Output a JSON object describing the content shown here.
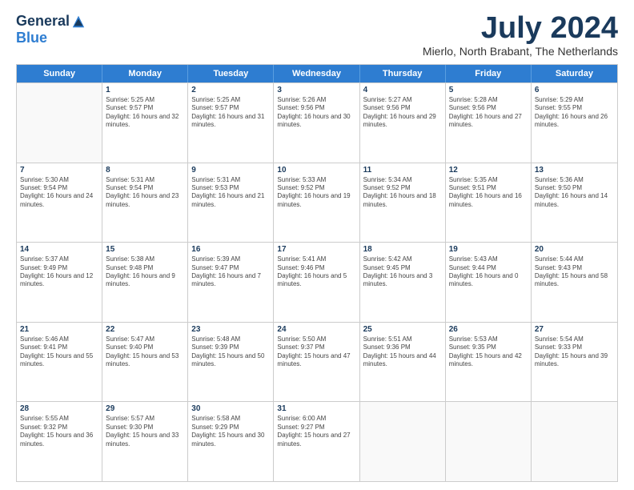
{
  "logo": {
    "general": "General",
    "blue": "Blue"
  },
  "header": {
    "month": "July 2024",
    "location": "Mierlo, North Brabant, The Netherlands"
  },
  "weekdays": [
    "Sunday",
    "Monday",
    "Tuesday",
    "Wednesday",
    "Thursday",
    "Friday",
    "Saturday"
  ],
  "rows": [
    [
      {
        "day": "",
        "empty": true
      },
      {
        "day": "1",
        "sunrise": "Sunrise: 5:25 AM",
        "sunset": "Sunset: 9:57 PM",
        "daylight": "Daylight: 16 hours and 32 minutes."
      },
      {
        "day": "2",
        "sunrise": "Sunrise: 5:25 AM",
        "sunset": "Sunset: 9:57 PM",
        "daylight": "Daylight: 16 hours and 31 minutes."
      },
      {
        "day": "3",
        "sunrise": "Sunrise: 5:26 AM",
        "sunset": "Sunset: 9:56 PM",
        "daylight": "Daylight: 16 hours and 30 minutes."
      },
      {
        "day": "4",
        "sunrise": "Sunrise: 5:27 AM",
        "sunset": "Sunset: 9:56 PM",
        "daylight": "Daylight: 16 hours and 29 minutes."
      },
      {
        "day": "5",
        "sunrise": "Sunrise: 5:28 AM",
        "sunset": "Sunset: 9:56 PM",
        "daylight": "Daylight: 16 hours and 27 minutes."
      },
      {
        "day": "6",
        "sunrise": "Sunrise: 5:29 AM",
        "sunset": "Sunset: 9:55 PM",
        "daylight": "Daylight: 16 hours and 26 minutes."
      }
    ],
    [
      {
        "day": "7",
        "sunrise": "Sunrise: 5:30 AM",
        "sunset": "Sunset: 9:54 PM",
        "daylight": "Daylight: 16 hours and 24 minutes."
      },
      {
        "day": "8",
        "sunrise": "Sunrise: 5:31 AM",
        "sunset": "Sunset: 9:54 PM",
        "daylight": "Daylight: 16 hours and 23 minutes."
      },
      {
        "day": "9",
        "sunrise": "Sunrise: 5:31 AM",
        "sunset": "Sunset: 9:53 PM",
        "daylight": "Daylight: 16 hours and 21 minutes."
      },
      {
        "day": "10",
        "sunrise": "Sunrise: 5:33 AM",
        "sunset": "Sunset: 9:52 PM",
        "daylight": "Daylight: 16 hours and 19 minutes."
      },
      {
        "day": "11",
        "sunrise": "Sunrise: 5:34 AM",
        "sunset": "Sunset: 9:52 PM",
        "daylight": "Daylight: 16 hours and 18 minutes."
      },
      {
        "day": "12",
        "sunrise": "Sunrise: 5:35 AM",
        "sunset": "Sunset: 9:51 PM",
        "daylight": "Daylight: 16 hours and 16 minutes."
      },
      {
        "day": "13",
        "sunrise": "Sunrise: 5:36 AM",
        "sunset": "Sunset: 9:50 PM",
        "daylight": "Daylight: 16 hours and 14 minutes."
      }
    ],
    [
      {
        "day": "14",
        "sunrise": "Sunrise: 5:37 AM",
        "sunset": "Sunset: 9:49 PM",
        "daylight": "Daylight: 16 hours and 12 minutes."
      },
      {
        "day": "15",
        "sunrise": "Sunrise: 5:38 AM",
        "sunset": "Sunset: 9:48 PM",
        "daylight": "Daylight: 16 hours and 9 minutes."
      },
      {
        "day": "16",
        "sunrise": "Sunrise: 5:39 AM",
        "sunset": "Sunset: 9:47 PM",
        "daylight": "Daylight: 16 hours and 7 minutes."
      },
      {
        "day": "17",
        "sunrise": "Sunrise: 5:41 AM",
        "sunset": "Sunset: 9:46 PM",
        "daylight": "Daylight: 16 hours and 5 minutes."
      },
      {
        "day": "18",
        "sunrise": "Sunrise: 5:42 AM",
        "sunset": "Sunset: 9:45 PM",
        "daylight": "Daylight: 16 hours and 3 minutes."
      },
      {
        "day": "19",
        "sunrise": "Sunrise: 5:43 AM",
        "sunset": "Sunset: 9:44 PM",
        "daylight": "Daylight: 16 hours and 0 minutes."
      },
      {
        "day": "20",
        "sunrise": "Sunrise: 5:44 AM",
        "sunset": "Sunset: 9:43 PM",
        "daylight": "Daylight: 15 hours and 58 minutes."
      }
    ],
    [
      {
        "day": "21",
        "sunrise": "Sunrise: 5:46 AM",
        "sunset": "Sunset: 9:41 PM",
        "daylight": "Daylight: 15 hours and 55 minutes."
      },
      {
        "day": "22",
        "sunrise": "Sunrise: 5:47 AM",
        "sunset": "Sunset: 9:40 PM",
        "daylight": "Daylight: 15 hours and 53 minutes."
      },
      {
        "day": "23",
        "sunrise": "Sunrise: 5:48 AM",
        "sunset": "Sunset: 9:39 PM",
        "daylight": "Daylight: 15 hours and 50 minutes."
      },
      {
        "day": "24",
        "sunrise": "Sunrise: 5:50 AM",
        "sunset": "Sunset: 9:37 PM",
        "daylight": "Daylight: 15 hours and 47 minutes."
      },
      {
        "day": "25",
        "sunrise": "Sunrise: 5:51 AM",
        "sunset": "Sunset: 9:36 PM",
        "daylight": "Daylight: 15 hours and 44 minutes."
      },
      {
        "day": "26",
        "sunrise": "Sunrise: 5:53 AM",
        "sunset": "Sunset: 9:35 PM",
        "daylight": "Daylight: 15 hours and 42 minutes."
      },
      {
        "day": "27",
        "sunrise": "Sunrise: 5:54 AM",
        "sunset": "Sunset: 9:33 PM",
        "daylight": "Daylight: 15 hours and 39 minutes."
      }
    ],
    [
      {
        "day": "28",
        "sunrise": "Sunrise: 5:55 AM",
        "sunset": "Sunset: 9:32 PM",
        "daylight": "Daylight: 15 hours and 36 minutes."
      },
      {
        "day": "29",
        "sunrise": "Sunrise: 5:57 AM",
        "sunset": "Sunset: 9:30 PM",
        "daylight": "Daylight: 15 hours and 33 minutes."
      },
      {
        "day": "30",
        "sunrise": "Sunrise: 5:58 AM",
        "sunset": "Sunset: 9:29 PM",
        "daylight": "Daylight: 15 hours and 30 minutes."
      },
      {
        "day": "31",
        "sunrise": "Sunrise: 6:00 AM",
        "sunset": "Sunset: 9:27 PM",
        "daylight": "Daylight: 15 hours and 27 minutes."
      },
      {
        "day": "",
        "empty": true
      },
      {
        "day": "",
        "empty": true
      },
      {
        "day": "",
        "empty": true
      }
    ]
  ]
}
